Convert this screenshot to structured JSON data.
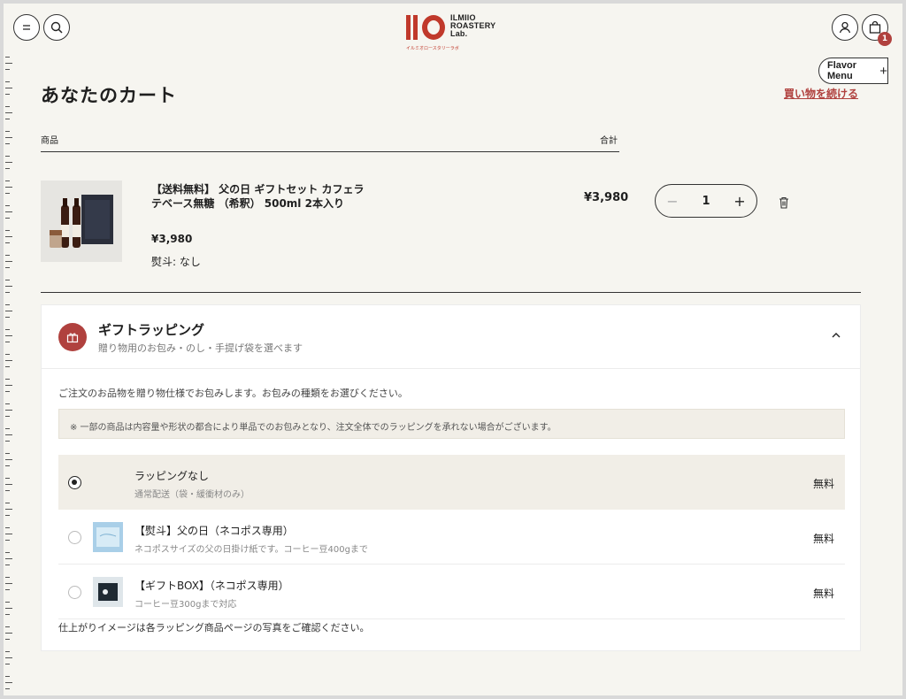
{
  "header": {
    "logo_text_line1": "ILMIIO",
    "logo_text_line2": "ROASTERY",
    "logo_text_line3": "Lab.",
    "logo_sub": "イルミオロースタリーラボ",
    "cart_count": "1",
    "flavor_menu_label": "Flavor Menu",
    "flavor_menu_plus": "+"
  },
  "cart": {
    "title": "あなたのカート",
    "continue_label": "買い物を続ける",
    "col_product": "商品",
    "col_total": "合計",
    "item": {
      "name": "【送料無料】 父の日 ギフトセット カフェラテベース無糖 （希釈） 500ml 2本入り",
      "price": "¥3,980",
      "noshi": "熨斗: なし",
      "line_total": "¥3,980",
      "quantity": "1",
      "minus": "−",
      "plus": "+"
    }
  },
  "gift": {
    "title": "ギフトラッピング",
    "subtitle": "贈り物用のお包み・のし・手提げ袋を選べます",
    "description": "ご注文のお品物を贈り物仕様でお包みします。お包みの種類をお選びください。",
    "note": "※ 一部の商品は内容量や形状の都合により単品でのお包みとなり、注文全体でのラッピングを承れない場合がございます。",
    "options": [
      {
        "title": "ラッピングなし",
        "sub": "通常配送（袋・緩衝材のみ）",
        "price": "無料"
      },
      {
        "title": "【熨斗】父の日（ネコポス専用）",
        "sub": "ネコポスサイズの父の日掛け紙です。コーヒー豆400gまで",
        "price": "無料"
      },
      {
        "title": "【ギフトBOX】（ネコポス専用）",
        "sub": "コーヒー豆300gまで対応",
        "price": "無料"
      }
    ],
    "footer": "仕上がりイメージは各ラッピング商品ページの写真をご確認ください。"
  },
  "colors": {
    "accent": "#b0413e",
    "brand_red": "#c0392b",
    "background": "#f6f5f0",
    "selected_option": "#f1eee7"
  },
  "icons": [
    "menu-icon",
    "search-icon",
    "user-icon",
    "bag-icon",
    "trash-icon",
    "gift-icon",
    "chevron-up-icon"
  ]
}
